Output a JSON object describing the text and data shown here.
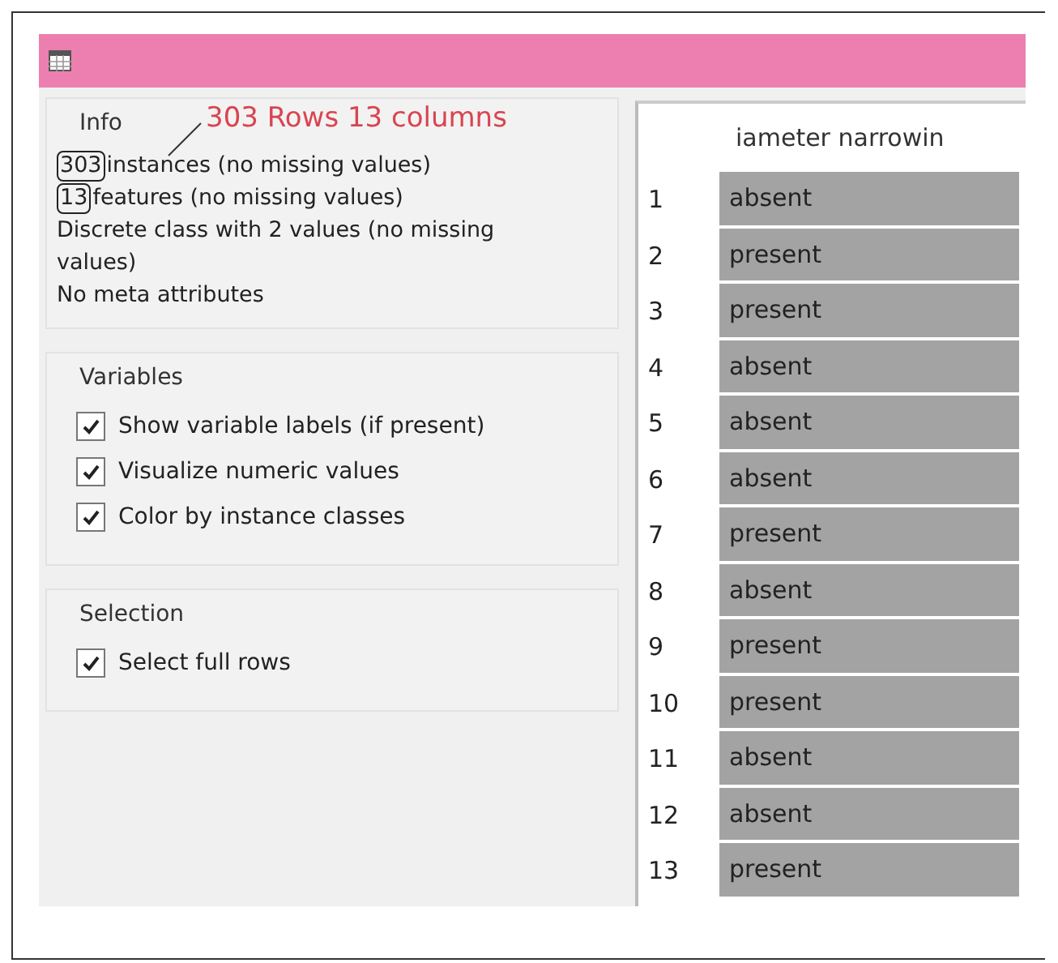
{
  "annotation": {
    "text": "303 Rows 13 columns"
  },
  "info": {
    "title": "Info",
    "lines": [
      {
        "text": "instances (no missing values)",
        "circled": "303"
      },
      {
        "text": "features (no missing values)",
        "circled": "13"
      },
      {
        "text": "Discrete class with 2 values (no missing values)"
      },
      {
        "text": "No meta attributes"
      }
    ]
  },
  "variables": {
    "title": "Variables",
    "options": [
      {
        "label": "Show variable labels (if present)",
        "checked": true
      },
      {
        "label": "Visualize numeric values",
        "checked": true
      },
      {
        "label": "Color by instance classes",
        "checked": true
      }
    ]
  },
  "selection": {
    "title": "Selection",
    "options": [
      {
        "label": "Select full rows",
        "checked": true
      }
    ]
  },
  "table": {
    "columns": [
      "iameter narrowin"
    ],
    "rows": [
      {
        "index": "1",
        "value": "absent"
      },
      {
        "index": "2",
        "value": "present"
      },
      {
        "index": "3",
        "value": "present"
      },
      {
        "index": "4",
        "value": "absent"
      },
      {
        "index": "5",
        "value": "absent"
      },
      {
        "index": "6",
        "value": "absent"
      },
      {
        "index": "7",
        "value": "present"
      },
      {
        "index": "8",
        "value": "absent"
      },
      {
        "index": "9",
        "value": "present"
      },
      {
        "index": "10",
        "value": "present"
      },
      {
        "index": "11",
        "value": "absent"
      },
      {
        "index": "12",
        "value": "absent"
      },
      {
        "index": "13",
        "value": "present"
      }
    ]
  }
}
